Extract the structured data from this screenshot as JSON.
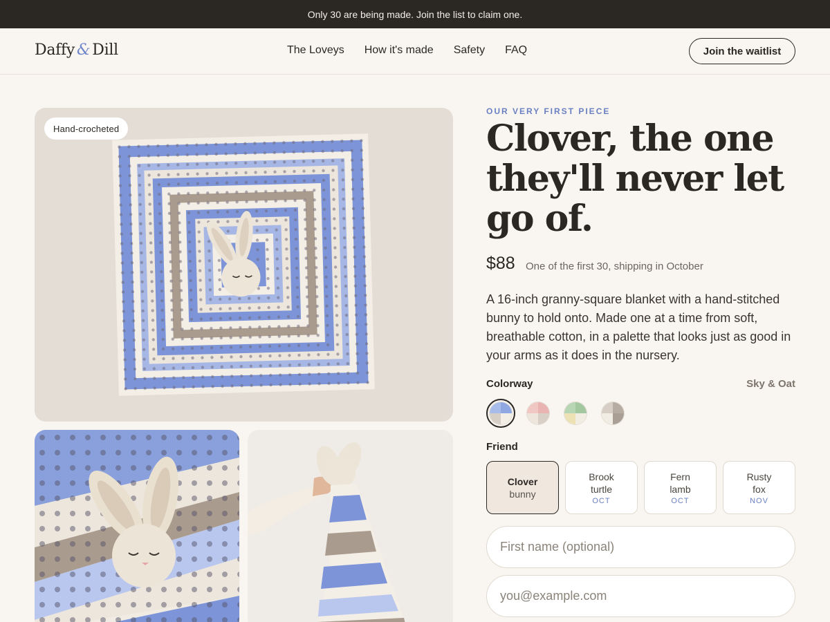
{
  "announcement": "Only 30 are being made. Join the list to claim one.",
  "brand": {
    "name_left": "Daffy",
    "ampersand": "&",
    "name_right": "Dill"
  },
  "nav": {
    "links": [
      "The Loveys",
      "How it's made",
      "Safety",
      "FAQ"
    ],
    "cta": "Join the waitlist"
  },
  "gallery": {
    "tag": "Hand-crocheted",
    "palette": {
      "sky": "#7d95d8",
      "oat": "#f2ece1",
      "taupe": "#a99b8d",
      "linen": "#e3ddd6"
    }
  },
  "product": {
    "eyebrow": "OUR VERY FIRST PIECE",
    "headline": "Clover, the one they'll never let go of.",
    "price": "$88",
    "price_note": "One of the first 30, shipping in October",
    "description": "A 16-inch granny-square blanket with a hand-stitched bunny to hold onto. Made one at a time from soft, breathable cotton, in a palette that looks just as good in your arms as it does in the nursery."
  },
  "colorway": {
    "label": "Colorway",
    "selected_name": "Sky & Oat",
    "swatches": [
      {
        "colors": [
          "#a7bce8",
          "#8fa8e2",
          "#d6cfc6",
          "#f4efe6"
        ],
        "selected": true
      },
      {
        "colors": [
          "#f1c7c4",
          "#e8b3b1",
          "#eee6dd",
          "#d8cfc6"
        ],
        "selected": false
      },
      {
        "colors": [
          "#b9d6b4",
          "#a3c79e",
          "#ede2b3",
          "#f2ede3"
        ],
        "selected": false
      },
      {
        "colors": [
          "#d7cfc6",
          "#b6aca1",
          "#f1ece4",
          "#a99f95"
        ],
        "selected": false
      }
    ]
  },
  "friend": {
    "label": "Friend",
    "options": [
      {
        "name": "Clover",
        "species": "bunny",
        "month": "",
        "selected": true
      },
      {
        "name": "Brook",
        "species": "turtle",
        "month": "OCT",
        "selected": false
      },
      {
        "name": "Fern",
        "species": "lamb",
        "month": "OCT",
        "selected": false
      },
      {
        "name": "Rusty",
        "species": "fox",
        "month": "NOV",
        "selected": false
      }
    ]
  },
  "form": {
    "first_name_placeholder": "First name (optional)",
    "email_placeholder": "you@example.com"
  }
}
